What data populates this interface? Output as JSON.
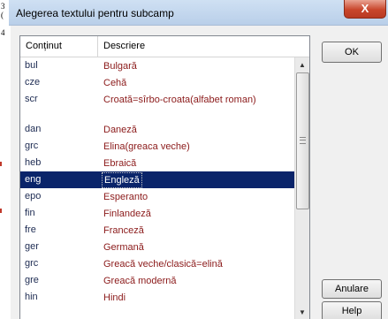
{
  "dialog": {
    "title": "Alegerea textului pentru subcamp",
    "close_label": "X"
  },
  "list": {
    "columns": [
      "Conținut",
      "Descriere"
    ],
    "rows": [
      {
        "code": "bul",
        "desc": "Bulgară"
      },
      {
        "code": "cze",
        "desc": "Cehă"
      },
      {
        "code": "scr",
        "desc": "Croată=sîrbo-croata(alfabet roman)"
      },
      {
        "code": "dan",
        "desc": "Daneză"
      },
      {
        "code": "grc",
        "desc": "Elina(greaca veche)"
      },
      {
        "code": "heb",
        "desc": "Ebraică"
      },
      {
        "code": "eng",
        "desc": "Engleză",
        "selected": true
      },
      {
        "code": "epo",
        "desc": "Esperanto"
      },
      {
        "code": "fin",
        "desc": "Finlandeză"
      },
      {
        "code": "fre",
        "desc": "Franceză"
      },
      {
        "code": "ger",
        "desc": "Germană"
      },
      {
        "code": "grc",
        "desc": "Greacă  veche/clasică=elină"
      },
      {
        "code": "gre",
        "desc": "Greacă  modernă"
      },
      {
        "code": "hin",
        "desc": "Hindi"
      }
    ]
  },
  "buttons": {
    "ok": "OK",
    "cancel": "Anulare",
    "help": "Help"
  },
  "background": {
    "edge_chars": [
      "3",
      "(",
      "4"
    ]
  },
  "colors": {
    "selection": "#0a246a",
    "code_text": "#1d2b52",
    "desc_text": "#8b1a1a"
  },
  "icons": {
    "close": "close-icon",
    "scroll_up": "scroll-up-arrow-icon",
    "scroll_down": "scroll-down-arrow-icon"
  }
}
